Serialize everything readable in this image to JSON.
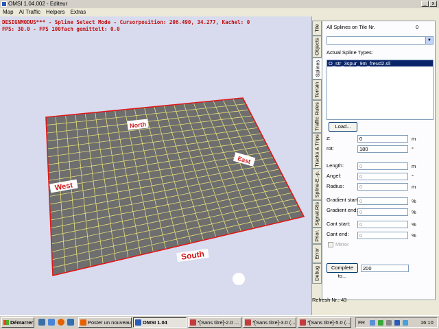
{
  "window": {
    "title": "OMSI 1.04.002 - Editeur"
  },
  "menu": [
    "Map",
    "AI Traffic",
    "Helpers",
    "Extras"
  ],
  "hud": {
    "line1": "DESIGNMODUS*** - Spline Select Mode - Cursorposition: 206.490, 34.277, Kachel: 0",
    "line2": "FPS: 30.0 - FPS 100fach gemittelt: 0.0"
  },
  "compass": {
    "north": "North",
    "south": "South",
    "east": "East",
    "west": "West"
  },
  "tabs": [
    "Tile",
    "Objects",
    "Splines",
    "Terrain",
    "Traffic Rules",
    "Tracks & Trips",
    "Spline-E.-p.",
    "Signal.Rts",
    "Prior.",
    "Error",
    "Debug"
  ],
  "active_tab": "Splines",
  "panel": {
    "all_splines_label": "All Splines on Tile Nr.",
    "all_splines_value": "0",
    "tile_splines_dropdown": "",
    "actual_types_label": "Actual Spline Types:",
    "actual_types_items": [
      "O_str_3spur_9m_freud2.sli"
    ],
    "load_button": "Load...",
    "z_label": "z:",
    "z_value": "0",
    "z_unit": "m",
    "rot_label": "rot:",
    "rot_value": "180",
    "rot_unit": "°",
    "length_label": "Length:",
    "length_value": "0",
    "length_unit": "m",
    "angle_label": "Angel:",
    "angle_value": "0",
    "angle_unit": "°",
    "radius_label": "Radius:",
    "radius_value": "0",
    "radius_unit": "m",
    "gradient_start_label": "Gradient start:",
    "gradient_start_value": "0",
    "gradient_start_unit": "%",
    "gradient_end_label": "Gradient end:",
    "gradient_end_value": "0",
    "gradient_end_unit": "%",
    "cant_start_label": "Cant start:",
    "cant_start_value": "0",
    "cant_start_unit": "%",
    "cant_end_label": "Cant end:",
    "cant_end_value": "0",
    "cant_end_unit": "%",
    "mirror_label": "Mirror",
    "complete_button": "Complete to...",
    "complete_value": "200",
    "refresh_label": "Refresh Nr.: 43"
  },
  "taskbar": {
    "start": "Démarrer",
    "tasks": [
      {
        "label": "Poster un nouveau...",
        "icon": "firefox-icon",
        "color": "#e66000"
      },
      {
        "label": "OMSI 1.04",
        "icon": "omsi-icon",
        "color": "#2a5bb8",
        "active": true
      },
      {
        "label": "*[Sans titre]-2.0 ...",
        "icon": "paint-icon",
        "color": "#c33c3c"
      },
      {
        "label": "*[Sans titre]-3.0 (...",
        "icon": "paint-icon",
        "color": "#c33c3c"
      },
      {
        "label": "*[Sans titre]-5.0 (...",
        "icon": "paint-icon",
        "color": "#c33c3c"
      }
    ],
    "language": "FR",
    "clock": "16:10"
  },
  "colors": {
    "grid_fill": "#6e6e6e",
    "grid_line": "#e6e07a",
    "grid_border": "#e01818",
    "viewport_bg": "#d8dbee",
    "hud": "#c01010"
  }
}
